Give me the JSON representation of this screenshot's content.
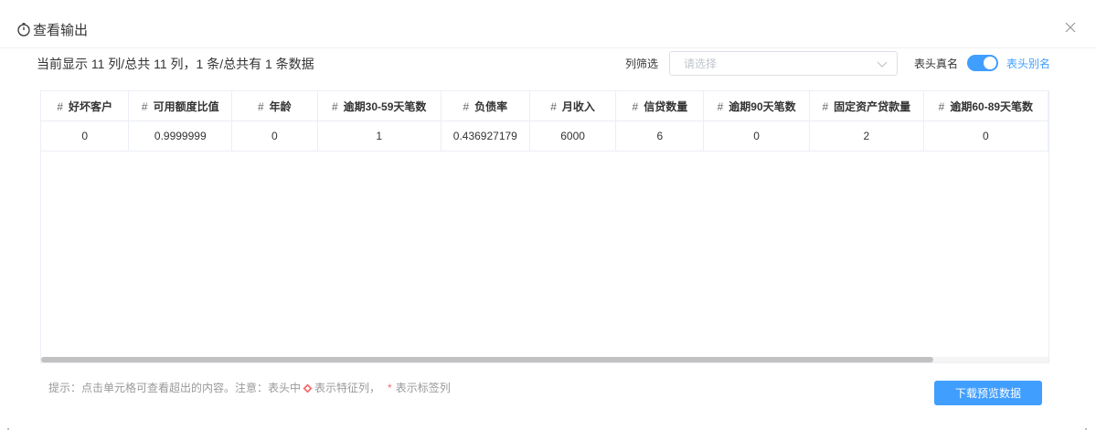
{
  "dialog": {
    "title": "查看输出",
    "close_icon": "close-icon"
  },
  "summary": "当前显示 11 列/总共 11 列，1 条/总共有 1 条数据",
  "filter": {
    "label": "列筛选",
    "placeholder": "请选择"
  },
  "header_toggle": {
    "real_label": "表头真名",
    "alias_label": "表头别名",
    "on": true,
    "accent": "#409eff"
  },
  "table": {
    "columns": [
      "好坏客户",
      "可用额度比值",
      "年龄",
      "逾期30-59天笔数",
      "负债率",
      "月收入",
      "信贷数量",
      "逾期90天笔数",
      "固定资产贷款量",
      "逾期60-89天笔数"
    ],
    "rows": [
      [
        "0",
        "0.9999999",
        "0",
        "1",
        "0.436927179",
        "6000",
        "6",
        "0",
        "2",
        "0"
      ]
    ]
  },
  "footer": {
    "hint_prefix": "提示：点击单元格可查看超出的内容。注意：表头中",
    "hint_feature": "表示特征列，",
    "hint_star": "*",
    "hint_label": "表示标签列",
    "download_label": "下载预览数据"
  }
}
